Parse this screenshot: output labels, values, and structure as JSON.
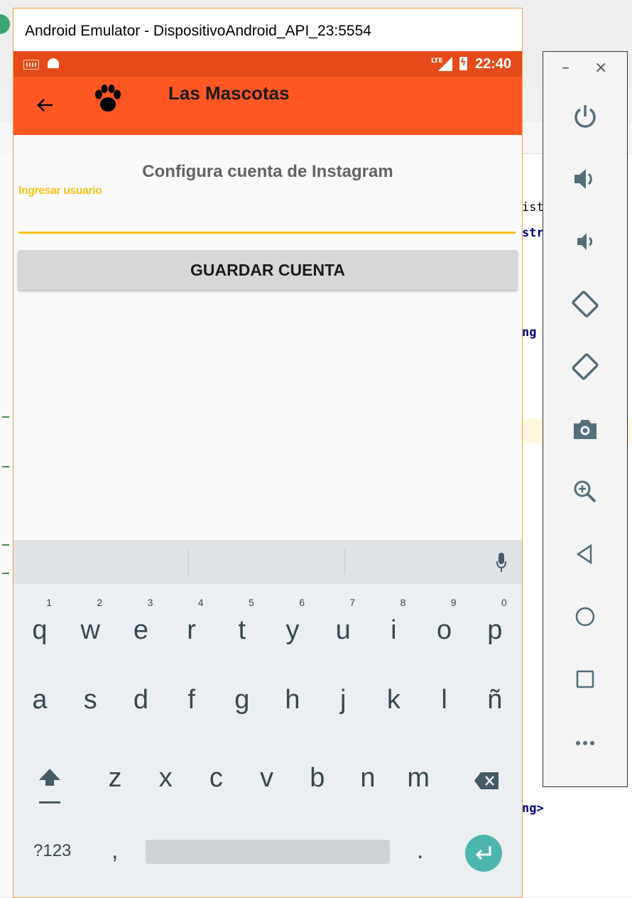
{
  "emulator": {
    "window_title": "Android Emulator - DispositivoAndroid_API_23:5554",
    "status_bar": {
      "network": "LTE",
      "time": "22:40"
    },
    "app_bar": {
      "title": "Las Mascotas"
    },
    "screen": {
      "heading": "Configura cuenta de Instagram",
      "username_field": {
        "label": "Ingresar usuario",
        "value": ""
      },
      "save_button": "GUARDAR CUENTA"
    },
    "keyboard": {
      "row1": [
        {
          "key": "q",
          "num": "1"
        },
        {
          "key": "w",
          "num": "2"
        },
        {
          "key": "e",
          "num": "3"
        },
        {
          "key": "r",
          "num": "4"
        },
        {
          "key": "t",
          "num": "5"
        },
        {
          "key": "y",
          "num": "6"
        },
        {
          "key": "u",
          "num": "7"
        },
        {
          "key": "i",
          "num": "8"
        },
        {
          "key": "o",
          "num": "9"
        },
        {
          "key": "p",
          "num": "0"
        }
      ],
      "row2": [
        "a",
        "s",
        "d",
        "f",
        "g",
        "h",
        "j",
        "k",
        "l",
        "ñ"
      ],
      "row3": [
        "z",
        "x",
        "c",
        "v",
        "b",
        "n",
        "m"
      ],
      "symbols_key": "?123",
      "comma_key": ",",
      "period_key": "."
    },
    "side_panel": {
      "minimize": "–",
      "close": "×",
      "buttons": [
        "power-icon",
        "volume-up-icon",
        "volume-down-icon",
        "rotate-left-icon",
        "rotate-right-icon",
        "camera-icon",
        "zoom-icon",
        "back-icon",
        "home-icon",
        "overview-icon",
        "more-icon"
      ]
    }
  },
  "background_ide": {
    "fragments": [
      "ist",
      "str",
      "ng",
      "ng>"
    ]
  }
}
